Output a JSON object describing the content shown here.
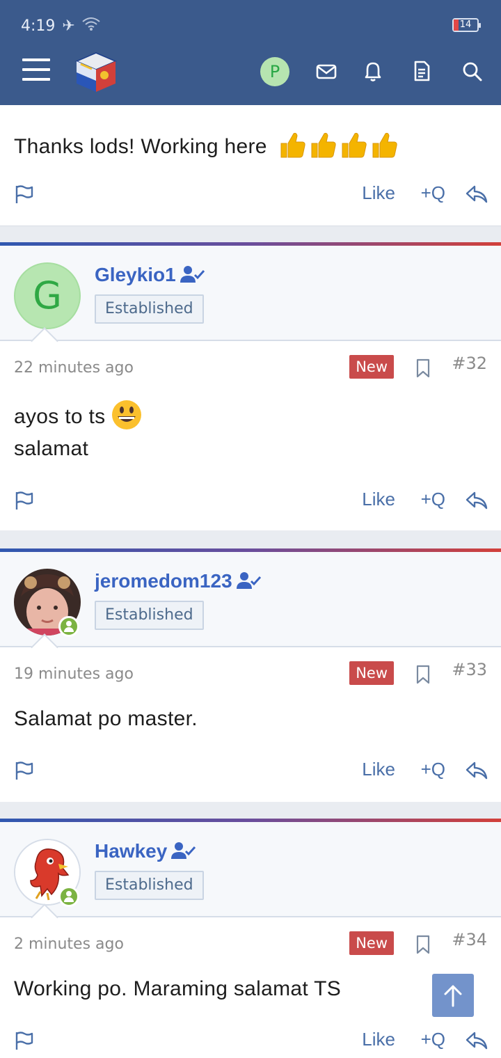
{
  "status_bar": {
    "time": "4:19",
    "battery": "14"
  },
  "nav": {
    "avatar_letter": "P"
  },
  "previous_post": {
    "text": "Thanks lods! Working here",
    "thumbs_count": 4,
    "like_label": "Like",
    "quote_label": "+Q"
  },
  "posts": [
    {
      "username": "Gleykio1",
      "avatar_letter": "G",
      "rank": "Established",
      "time": "22 minutes ago",
      "badge": "New",
      "number": "#32",
      "lines": [
        "ayos to ts",
        "salamat"
      ],
      "like_label": "Like",
      "quote_label": "+Q"
    },
    {
      "username": "jeromedom123",
      "rank": "Established",
      "time": "19 minutes ago",
      "badge": "New",
      "number": "#33",
      "lines": [
        "Salamat po master."
      ],
      "like_label": "Like",
      "quote_label": "+Q"
    },
    {
      "username": "Hawkey",
      "rank": "Established",
      "time": "2 minutes ago",
      "badge": "New",
      "number": "#34",
      "lines": [
        "Working po. Maraming salamat TS"
      ],
      "like_label": "Like",
      "quote_label": "+Q"
    }
  ]
}
